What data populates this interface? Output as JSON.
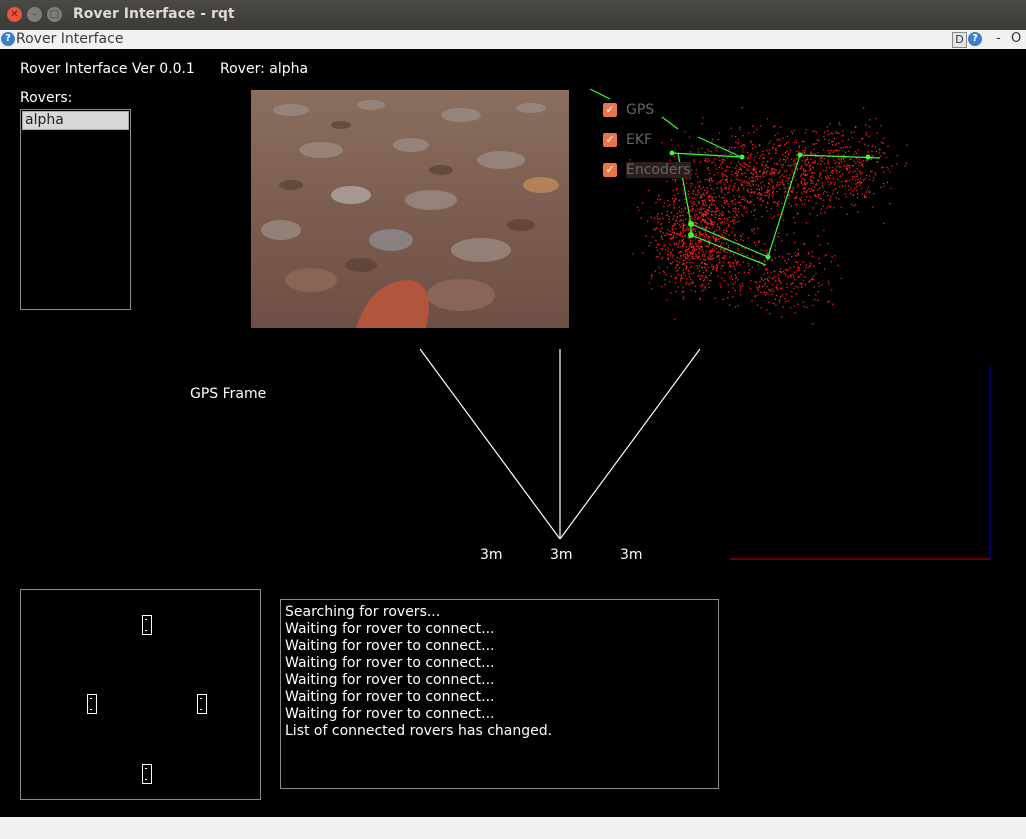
{
  "window": {
    "title": "Rover Interface - rqt"
  },
  "menubar": {
    "plugin_title": "Rover Interface",
    "d_label": "D",
    "help_label": "?",
    "minus_label": "-",
    "o_label": "O"
  },
  "header": {
    "version": "Rover Interface Ver 0.0.1",
    "rover_label": "Rover: alpha"
  },
  "rovers": {
    "label": "Rovers:",
    "items": [
      "alpha"
    ]
  },
  "map": {
    "layers": [
      {
        "label": "GPS",
        "checked": true
      },
      {
        "label": "EKF",
        "checked": true
      },
      {
        "label": "Encoders",
        "checked": true
      }
    ],
    "colors": {
      "particles": "#ff2020",
      "path": "#33ff33",
      "check": "#e8764a"
    }
  },
  "gps_frame": {
    "label": "GPS Frame",
    "range_labels": [
      "3m",
      "3m",
      "3m"
    ],
    "axis_colors": {
      "x": "#cc0000",
      "y": "#0000cc"
    }
  },
  "log": {
    "lines": [
      "Searching for rovers...",
      "Waiting for rover to connect...",
      "Waiting for rover to connect...",
      "Waiting for rover to connect...",
      "Waiting for rover to connect...",
      "Waiting for rover to connect...",
      "Waiting for rover to connect...",
      "List of connected rovers has changed."
    ]
  }
}
